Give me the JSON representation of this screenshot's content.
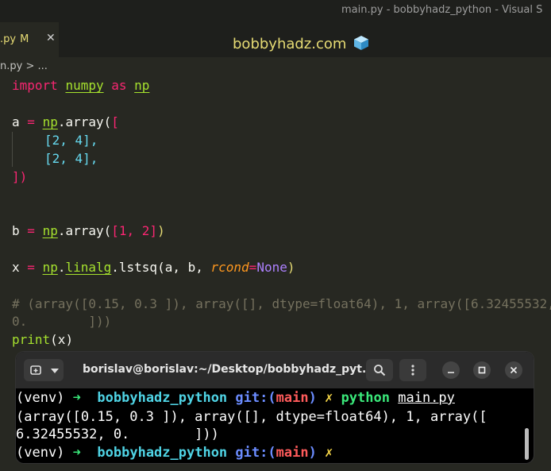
{
  "window": {
    "title": "main.py - bobbyhadz_python - Visual S"
  },
  "tab": {
    "name": ".py",
    "modified": "M",
    "close": "✕"
  },
  "brand": {
    "text": "bobbyhadz.com"
  },
  "breadcrumb": {
    "text": "n.py > ..."
  },
  "code": {
    "l1_import": "import",
    "l1_module": "numpy",
    "l1_as": "as",
    "l1_alias": "np",
    "l3_var": "a",
    "l3_eq": "=",
    "l3_np": "np",
    "l3_fn": ".array(",
    "l3_open": "[",
    "l4": "[2, 4],",
    "l5": "[2, 4],",
    "l6": "])",
    "l9_var": "b",
    "l9_eq": "=",
    "l9_np": "np",
    "l9_fn": ".array(",
    "l9_list": "[1, 2]",
    "l9_close": ")",
    "l11_var": "x",
    "l11_eq": "=",
    "l11_np": "np",
    "l11_dot": ".",
    "l11_mod": "linalg",
    "l11_fn": ".lstsq(",
    "l11_args": "a, b, ",
    "l11_param": "rcond",
    "l11_peq": "=",
    "l11_none": "None",
    "l11_close": ")",
    "l13_comment": "# (array([0.15, 0.3 ]), array([], dtype=float64), 1, array([6.32455532,",
    "l14_comment": "0.        ]))",
    "l15_fn": "print",
    "l15_args": "(x)"
  },
  "terminal": {
    "title": "borislav@borislav:~/Desktop/bobbyhadz_pyt...",
    "new_tab_icon": "new-tab-icon",
    "line1": {
      "venv": "(venv)",
      "arrow": "➜",
      "dir": "bobbyhadz_python",
      "git": "git:(",
      "branch": "main",
      "git_close": ")",
      "x": "✗",
      "cmd": "python",
      "file": "main.py"
    },
    "line2": "(array([0.15, 0.3 ]), array([], dtype=float64), 1, array([",
    "line3": "6.32455532, 0.        ]))",
    "line4": {
      "venv": "(venv)",
      "arrow": "➜",
      "dir": "bobbyhadz_python",
      "git": "git:(",
      "branch": "main",
      "git_close": ")",
      "x": "✗"
    }
  }
}
